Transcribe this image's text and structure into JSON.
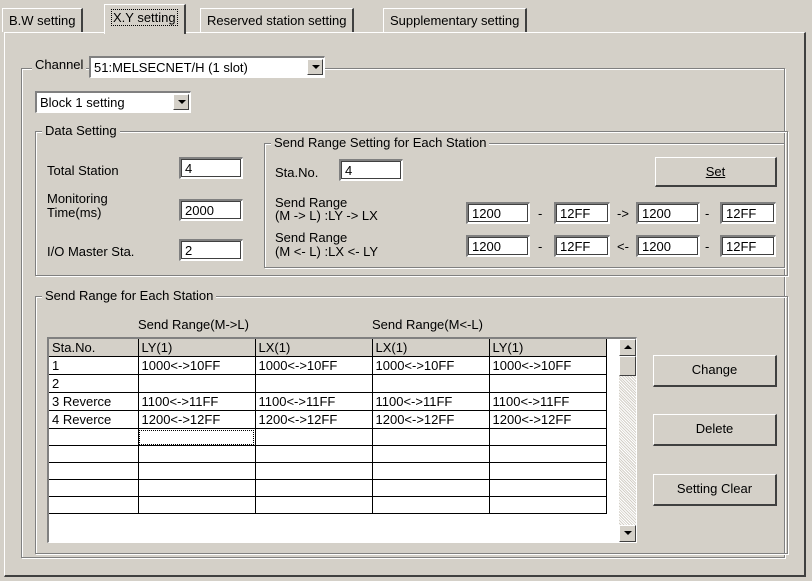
{
  "tabs": [
    {
      "label": "B.W setting"
    },
    {
      "label": "X.Y setting"
    },
    {
      "label": "Reserved station setting"
    },
    {
      "label": "Supplementary setting"
    }
  ],
  "channel": {
    "label": "Channel",
    "value": "51:MELSECNET/H (1 slot)"
  },
  "block": {
    "value": "Block 1 setting"
  },
  "data_setting": {
    "title": "Data Setting",
    "total_station_label": "Total Station",
    "total_station_value": "4",
    "monitoring_label_1": "Monitoring",
    "monitoring_label_2": "Time(ms)",
    "monitoring_value": "2000",
    "io_master_label": "I/O Master Sta.",
    "io_master_value": "2"
  },
  "send_range_setting": {
    "title": "Send Range Setting for Each Station",
    "sta_no_label": "Sta.No.",
    "sta_no_value": "4",
    "set_button": "Set",
    "row1_label_1": "Send Range",
    "row1_label_2": "(M -> L) :LY -> LX",
    "row2_label_1": "Send Range",
    "row2_label_2": "(M <- L) :LX <- LY",
    "row1": {
      "a": "1200",
      "b": "12FF",
      "c": "1200",
      "d": "12FF"
    },
    "row2": {
      "a": "1200",
      "b": "12FF",
      "c": "1200",
      "d": "12FF"
    },
    "dash": "-",
    "arrow_right": "->",
    "arrow_left": "<-"
  },
  "send_range_station": {
    "title": "Send Range for Each Station",
    "group_ml": "Send Range(M->L)",
    "group_lm": "Send Range(M<-L)",
    "columns": [
      "Sta.No.",
      "LY(1)",
      "LX(1)",
      "LX(1)",
      "LY(1)"
    ],
    "rows": [
      [
        "1",
        "1000<->10FF",
        "1000<->10FF",
        "1000<->10FF",
        "1000<->10FF"
      ],
      [
        "2",
        "",
        "",
        "",
        ""
      ],
      [
        "3 Reverce",
        "1100<->11FF",
        "1100<->11FF",
        "1100<->11FF",
        "1100<->11FF"
      ],
      [
        "4 Reverce",
        "1200<->12FF",
        "1200<->12FF",
        "1200<->12FF",
        "1200<->12FF"
      ],
      [
        "",
        "",
        "",
        "",
        ""
      ],
      [
        "",
        "",
        "",
        "",
        ""
      ],
      [
        "",
        "",
        "",
        "",
        ""
      ],
      [
        "",
        "",
        "",
        "",
        ""
      ],
      [
        "",
        "",
        "",
        "",
        ""
      ]
    ]
  },
  "buttons": {
    "change": "Change",
    "delete": "Delete",
    "clear": "Setting Clear"
  }
}
